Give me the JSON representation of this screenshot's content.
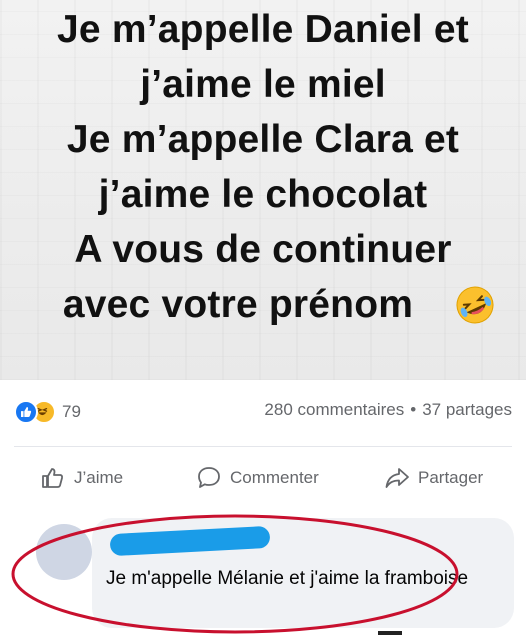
{
  "meme": {
    "lines": [
      "Je m’appelle Daniel et",
      "j’aime le miel",
      "Je m’appelle Clara et",
      "j’aime le chocolat",
      "A vous de continuer",
      "avec votre prénom"
    ],
    "emoji": "rolling-on-floor-laughing-emoji"
  },
  "post": {
    "reaction_icons": [
      "like-icon",
      "haha-icon"
    ],
    "reaction_count": "79",
    "comments_count": "280 commentaires",
    "separator": "•",
    "shares_count": "37 partages"
  },
  "actions": {
    "like_label": "J’aime",
    "comment_label": "Commenter",
    "share_label": "Partager"
  },
  "comment": {
    "text": "Je m'appelle Mélanie et j'aime la framboise"
  },
  "colors": {
    "facebook_blue": "#1877f2",
    "haha_yellow": "#f7b928",
    "secondary_text": "#65676b",
    "annotation_red": "#c8102e",
    "redaction_blue": "#1a9ce8",
    "bubble_bg": "#f0f2f5"
  }
}
